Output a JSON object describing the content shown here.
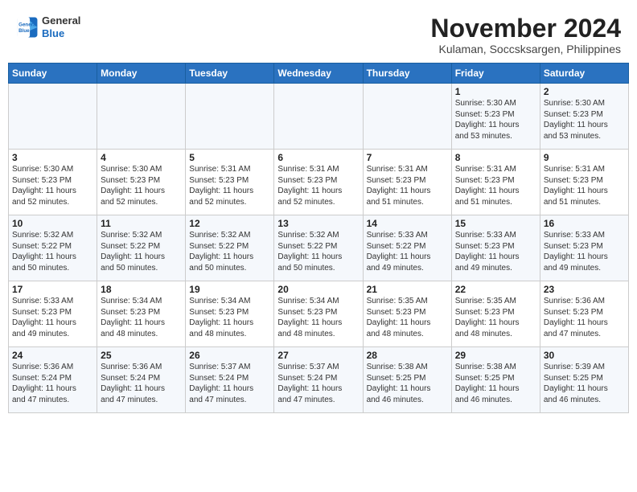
{
  "header": {
    "logo_line1": "General",
    "logo_line2": "Blue",
    "month": "November 2024",
    "location": "Kulaman, Soccsksargen, Philippines"
  },
  "weekdays": [
    "Sunday",
    "Monday",
    "Tuesday",
    "Wednesday",
    "Thursday",
    "Friday",
    "Saturday"
  ],
  "weeks": [
    [
      {
        "day": "",
        "info": ""
      },
      {
        "day": "",
        "info": ""
      },
      {
        "day": "",
        "info": ""
      },
      {
        "day": "",
        "info": ""
      },
      {
        "day": "",
        "info": ""
      },
      {
        "day": "1",
        "info": "Sunrise: 5:30 AM\nSunset: 5:23 PM\nDaylight: 11 hours\nand 53 minutes."
      },
      {
        "day": "2",
        "info": "Sunrise: 5:30 AM\nSunset: 5:23 PM\nDaylight: 11 hours\nand 53 minutes."
      }
    ],
    [
      {
        "day": "3",
        "info": "Sunrise: 5:30 AM\nSunset: 5:23 PM\nDaylight: 11 hours\nand 52 minutes."
      },
      {
        "day": "4",
        "info": "Sunrise: 5:30 AM\nSunset: 5:23 PM\nDaylight: 11 hours\nand 52 minutes."
      },
      {
        "day": "5",
        "info": "Sunrise: 5:31 AM\nSunset: 5:23 PM\nDaylight: 11 hours\nand 52 minutes."
      },
      {
        "day": "6",
        "info": "Sunrise: 5:31 AM\nSunset: 5:23 PM\nDaylight: 11 hours\nand 52 minutes."
      },
      {
        "day": "7",
        "info": "Sunrise: 5:31 AM\nSunset: 5:23 PM\nDaylight: 11 hours\nand 51 minutes."
      },
      {
        "day": "8",
        "info": "Sunrise: 5:31 AM\nSunset: 5:23 PM\nDaylight: 11 hours\nand 51 minutes."
      },
      {
        "day": "9",
        "info": "Sunrise: 5:31 AM\nSunset: 5:23 PM\nDaylight: 11 hours\nand 51 minutes."
      }
    ],
    [
      {
        "day": "10",
        "info": "Sunrise: 5:32 AM\nSunset: 5:22 PM\nDaylight: 11 hours\nand 50 minutes."
      },
      {
        "day": "11",
        "info": "Sunrise: 5:32 AM\nSunset: 5:22 PM\nDaylight: 11 hours\nand 50 minutes."
      },
      {
        "day": "12",
        "info": "Sunrise: 5:32 AM\nSunset: 5:22 PM\nDaylight: 11 hours\nand 50 minutes."
      },
      {
        "day": "13",
        "info": "Sunrise: 5:32 AM\nSunset: 5:22 PM\nDaylight: 11 hours\nand 50 minutes."
      },
      {
        "day": "14",
        "info": "Sunrise: 5:33 AM\nSunset: 5:22 PM\nDaylight: 11 hours\nand 49 minutes."
      },
      {
        "day": "15",
        "info": "Sunrise: 5:33 AM\nSunset: 5:23 PM\nDaylight: 11 hours\nand 49 minutes."
      },
      {
        "day": "16",
        "info": "Sunrise: 5:33 AM\nSunset: 5:23 PM\nDaylight: 11 hours\nand 49 minutes."
      }
    ],
    [
      {
        "day": "17",
        "info": "Sunrise: 5:33 AM\nSunset: 5:23 PM\nDaylight: 11 hours\nand 49 minutes."
      },
      {
        "day": "18",
        "info": "Sunrise: 5:34 AM\nSunset: 5:23 PM\nDaylight: 11 hours\nand 48 minutes."
      },
      {
        "day": "19",
        "info": "Sunrise: 5:34 AM\nSunset: 5:23 PM\nDaylight: 11 hours\nand 48 minutes."
      },
      {
        "day": "20",
        "info": "Sunrise: 5:34 AM\nSunset: 5:23 PM\nDaylight: 11 hours\nand 48 minutes."
      },
      {
        "day": "21",
        "info": "Sunrise: 5:35 AM\nSunset: 5:23 PM\nDaylight: 11 hours\nand 48 minutes."
      },
      {
        "day": "22",
        "info": "Sunrise: 5:35 AM\nSunset: 5:23 PM\nDaylight: 11 hours\nand 48 minutes."
      },
      {
        "day": "23",
        "info": "Sunrise: 5:36 AM\nSunset: 5:23 PM\nDaylight: 11 hours\nand 47 minutes."
      }
    ],
    [
      {
        "day": "24",
        "info": "Sunrise: 5:36 AM\nSunset: 5:24 PM\nDaylight: 11 hours\nand 47 minutes."
      },
      {
        "day": "25",
        "info": "Sunrise: 5:36 AM\nSunset: 5:24 PM\nDaylight: 11 hours\nand 47 minutes."
      },
      {
        "day": "26",
        "info": "Sunrise: 5:37 AM\nSunset: 5:24 PM\nDaylight: 11 hours\nand 47 minutes."
      },
      {
        "day": "27",
        "info": "Sunrise: 5:37 AM\nSunset: 5:24 PM\nDaylight: 11 hours\nand 47 minutes."
      },
      {
        "day": "28",
        "info": "Sunrise: 5:38 AM\nSunset: 5:25 PM\nDaylight: 11 hours\nand 46 minutes."
      },
      {
        "day": "29",
        "info": "Sunrise: 5:38 AM\nSunset: 5:25 PM\nDaylight: 11 hours\nand 46 minutes."
      },
      {
        "day": "30",
        "info": "Sunrise: 5:39 AM\nSunset: 5:25 PM\nDaylight: 11 hours\nand 46 minutes."
      }
    ]
  ]
}
